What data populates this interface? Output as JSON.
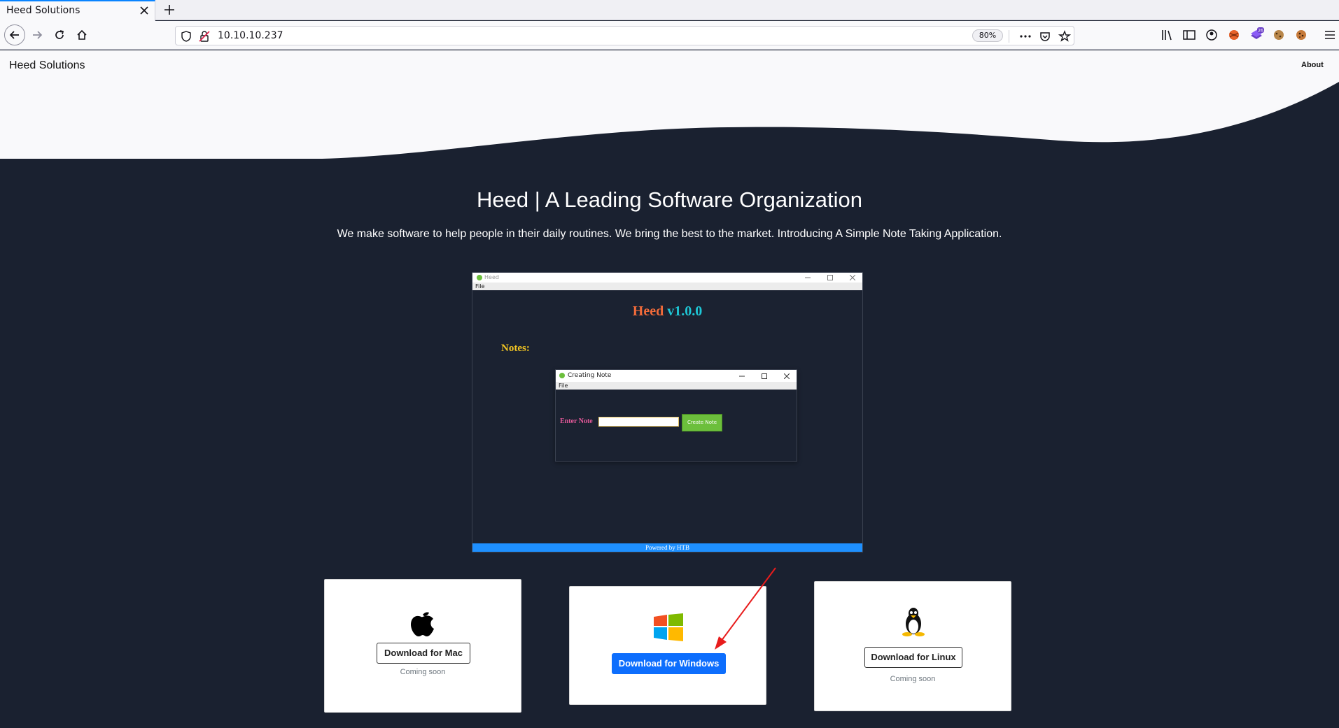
{
  "browser": {
    "tab_title": "Heed Solutions",
    "url": "10.10.10.237",
    "zoom": "80%",
    "badge_count": "26"
  },
  "site": {
    "brand": "Heed Solutions",
    "nav_about": "About",
    "hero_title": "Heed | A Leading Software Organization",
    "hero_subtitle": "We make software to help people in their daily routines. We bring the best to the market. Introducing A Simple Note Taking Application."
  },
  "app_preview": {
    "window_title": "Heed",
    "menu_file": "File",
    "heading_name": "Heed",
    "heading_version": "v1.0.0",
    "notes_label": "Notes:",
    "dialog_title": "Creating Note",
    "dialog_menu_file": "File",
    "enter_note_label": "Enter Note",
    "create_note_button": "Create Note",
    "footer": "Powered by HTB"
  },
  "downloads": {
    "mac": {
      "label": "Download for Mac",
      "status": "Coming soon"
    },
    "windows": {
      "label": "Download for Windows"
    },
    "linux": {
      "label": "Download for Linux",
      "status": "Coming soon"
    }
  },
  "colors": {
    "page_bg": "#1a2130",
    "accent_blue": "#0d6efd",
    "arrow": "#e81c1c"
  }
}
